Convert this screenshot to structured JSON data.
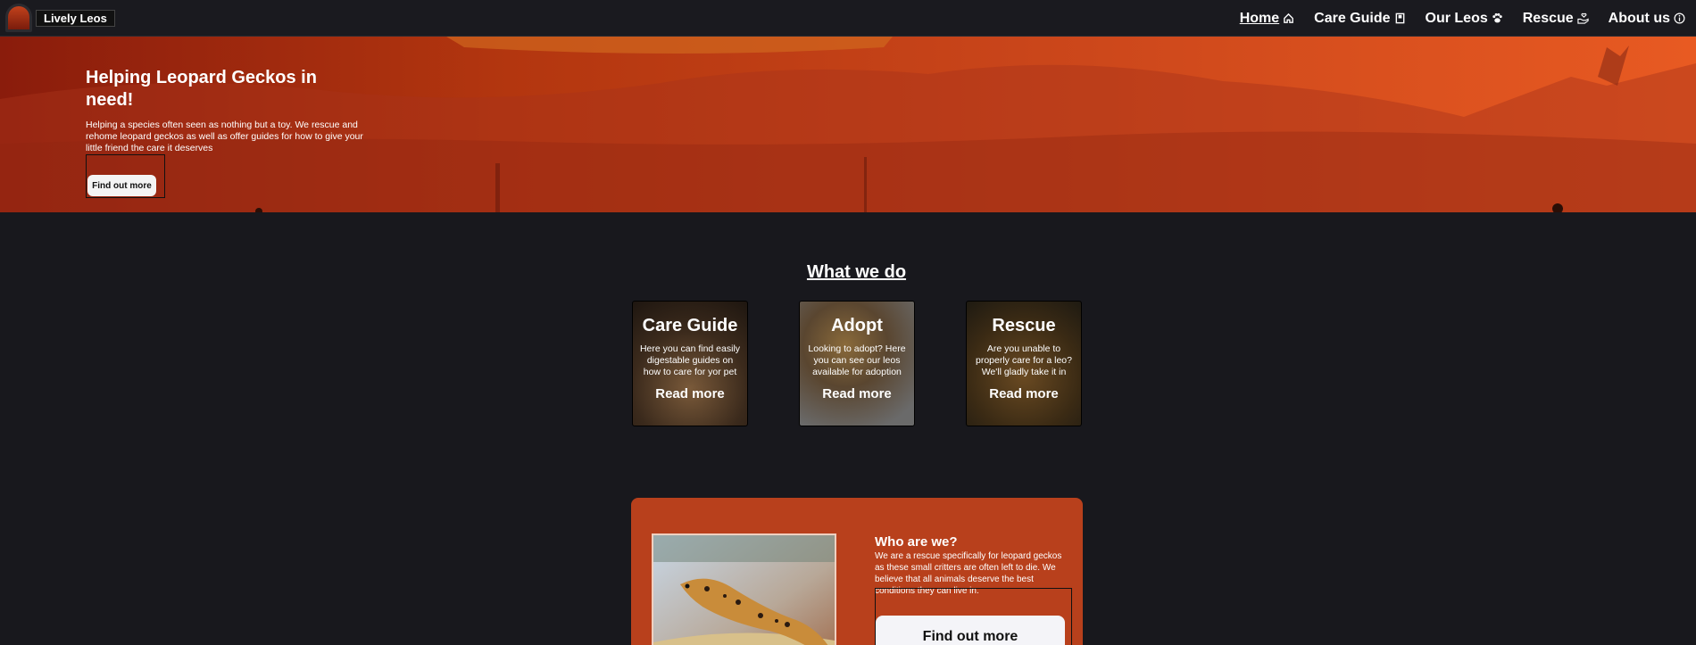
{
  "brand": {
    "name": "Lively Leos"
  },
  "nav": {
    "items": [
      {
        "label": "Home",
        "icon": "home-icon",
        "active": true
      },
      {
        "label": "Care Guide",
        "icon": "book-icon"
      },
      {
        "label": "Our Leos",
        "icon": "paw-icon"
      },
      {
        "label": "Rescue",
        "icon": "hand-heart-icon"
      },
      {
        "label": "About us",
        "icon": "info-icon"
      }
    ]
  },
  "hero": {
    "title": "Helping Leopard Geckos in need!",
    "description": "Helping a species often seen as nothing but a toy. We rescue and rehome leopard geckos as well as offer guides for how to give your little friend the care it deserves",
    "button_label": "Find out more"
  },
  "services": {
    "title": "What we do",
    "cards": [
      {
        "title": "Care Guide",
        "description": "Here you can find easily digestable guides on how to care for yor pet",
        "link": "Read more"
      },
      {
        "title": "Adopt",
        "description": "Looking to adopt? Here you can see our leos available for adoption",
        "link": "Read more"
      },
      {
        "title": "Rescue",
        "description": "Are you unable to properly care for a leo? We'll gladly take it in",
        "link": "Read more"
      }
    ]
  },
  "about": {
    "title": "Who are we?",
    "description": "We are a rescue specifically for leopard geckos as these small critters are often left to die. We believe that all animals deserve the best conditions they can live in.",
    "button_label": "Find out more"
  },
  "colors": {
    "nav_bg": "#1a1a1f",
    "page_bg": "#18181d",
    "accent": "#b8401c",
    "hero_start": "#8a1c0c",
    "hero_end": "#e85a22"
  }
}
